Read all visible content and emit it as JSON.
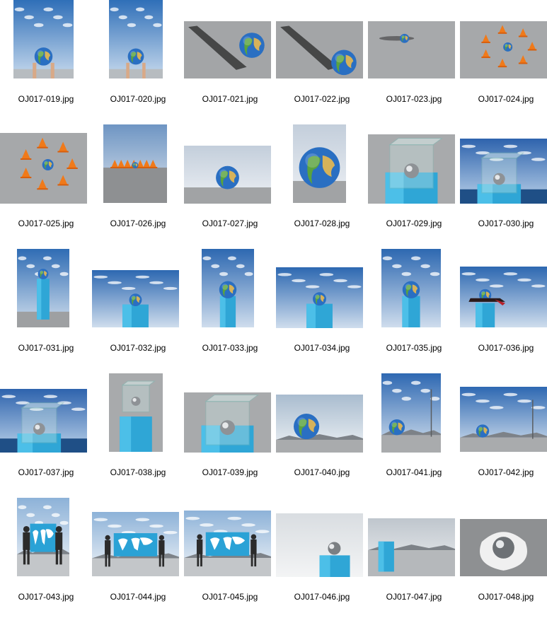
{
  "explorer": {
    "files": [
      {
        "name": "OJ017-019.jpg",
        "icon": "globe-sky-hands"
      },
      {
        "name": "OJ017-020.jpg",
        "icon": "globe-sky-hands"
      },
      {
        "name": "OJ017-021.jpg",
        "icon": "globe-shadow"
      },
      {
        "name": "OJ017-022.jpg",
        "icon": "globe-shadow"
      },
      {
        "name": "OJ017-023.jpg",
        "icon": "globe-small-ground"
      },
      {
        "name": "OJ017-024.jpg",
        "icon": "globe-cones"
      },
      {
        "name": "OJ017-025.jpg",
        "icon": "globe-cones"
      },
      {
        "name": "OJ017-026.jpg",
        "icon": "globe-cones-horizon"
      },
      {
        "name": "OJ017-027.jpg",
        "icon": "globe-horizon"
      },
      {
        "name": "OJ017-028.jpg",
        "icon": "globe-horizon"
      },
      {
        "name": "OJ017-029.jpg",
        "icon": "glass-case-pedestal"
      },
      {
        "name": "OJ017-030.jpg",
        "icon": "glass-case-sky"
      },
      {
        "name": "OJ017-031.jpg",
        "icon": "globe-tall-pedestal"
      },
      {
        "name": "OJ017-032.jpg",
        "icon": "globe-pedestal-sky"
      },
      {
        "name": "OJ017-033.jpg",
        "icon": "globe-pedestal-sky"
      },
      {
        "name": "OJ017-034.jpg",
        "icon": "globe-pedestal-sky"
      },
      {
        "name": "OJ017-035.jpg",
        "icon": "globe-pedestal-sky"
      },
      {
        "name": "OJ017-036.jpg",
        "icon": "globe-scarf-pedestal"
      },
      {
        "name": "OJ017-037.jpg",
        "icon": "glass-case-sky"
      },
      {
        "name": "OJ017-038.jpg",
        "icon": "glass-case-pedestal"
      },
      {
        "name": "OJ017-039.jpg",
        "icon": "glass-case-pedestal"
      },
      {
        "name": "OJ017-040.jpg",
        "icon": "globe-landscape"
      },
      {
        "name": "OJ017-041.jpg",
        "icon": "globe-landscape-pole"
      },
      {
        "name": "OJ017-042.jpg",
        "icon": "globe-landscape-pole"
      },
      {
        "name": "OJ017-043.jpg",
        "icon": "world-map-sign"
      },
      {
        "name": "OJ017-044.jpg",
        "icon": "world-map-sign"
      },
      {
        "name": "OJ017-045.jpg",
        "icon": "world-map-sign"
      },
      {
        "name": "OJ017-046.jpg",
        "icon": "silver-sphere-pedestal"
      },
      {
        "name": "OJ017-047.jpg",
        "icon": "pedestal-landscape"
      },
      {
        "name": "OJ017-048.jpg",
        "icon": "silver-sphere-cloth"
      }
    ]
  }
}
